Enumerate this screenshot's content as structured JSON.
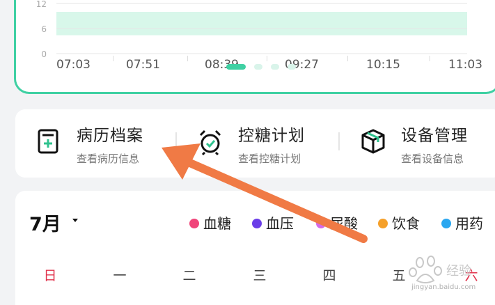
{
  "chart": {
    "y_ticks": [
      "12",
      "6",
      "0"
    ],
    "x_ticks": [
      "07:03",
      "07:51",
      "08:39",
      "09:27",
      "10:15",
      "11:03"
    ],
    "target_band": [
      4.4,
      10
    ],
    "band_color": "#d8f7ea",
    "pager_active_color": "#3fd0a3",
    "pager_inactive_color": "#d9f4ea"
  },
  "chart_data": {
    "type": "line",
    "x": [
      "07:03",
      "07:51",
      "08:39",
      "09:27",
      "10:15",
      "11:03"
    ],
    "ylim": [
      0,
      12
    ],
    "yticks": [
      0,
      6,
      12
    ],
    "series": [],
    "grid": true,
    "band": [
      4.4,
      10
    ]
  },
  "shortcuts": [
    {
      "title": "病历档案",
      "subtitle": "查看病历信息",
      "icon": "medical-record-icon"
    },
    {
      "title": "控糖计划",
      "subtitle": "查看控糖计划",
      "icon": "alarm-clock-icon"
    },
    {
      "title": "设备管理",
      "subtitle": "查看设备信息",
      "icon": "device-box-icon"
    }
  ],
  "calendar": {
    "month": "7月",
    "legend": [
      {
        "label": "血糖",
        "color": "#f0457a"
      },
      {
        "label": "血压",
        "color": "#6a3de8"
      },
      {
        "label": "尿酸",
        "color": "#d46ae8"
      },
      {
        "label": "饮食",
        "color": "#f5a02a"
      },
      {
        "label": "用药",
        "color": "#2aa7f0"
      }
    ],
    "weekdays": [
      "日",
      "一",
      "二",
      "三",
      "四",
      "五",
      "六"
    ]
  },
  "watermark": {
    "site": "jingyan.baidu.com",
    "brand": "Baidu 经验"
  },
  "colors": {
    "accent": "#3fd0a3",
    "arrow": "#f07a45"
  }
}
